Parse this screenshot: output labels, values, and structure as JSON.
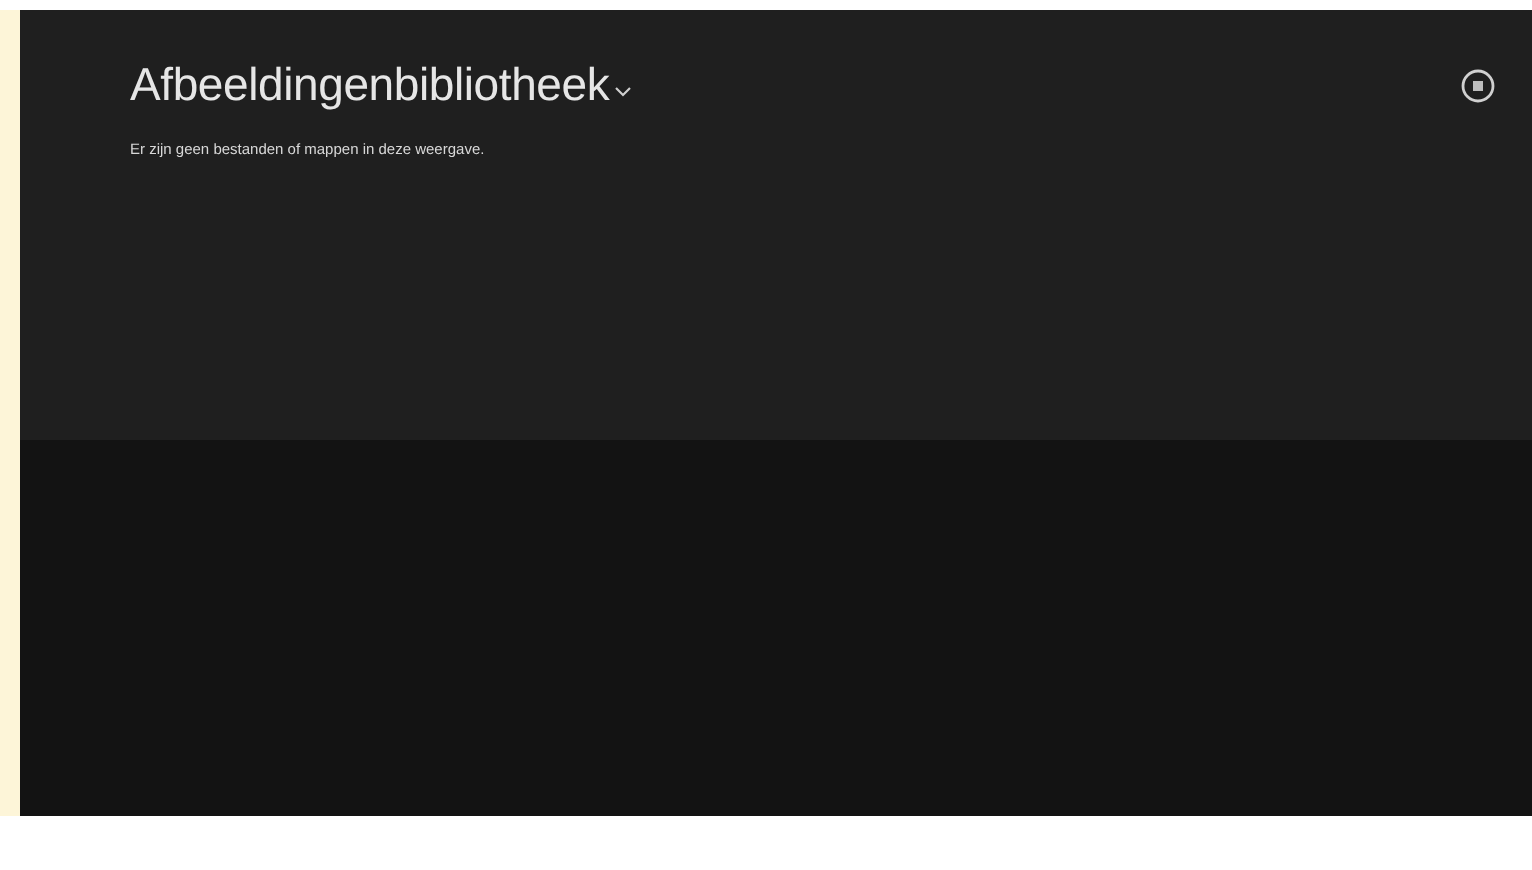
{
  "header": {
    "title": "Afbeeldingenbibliotheek",
    "message": "Er zijn geen bestanden of mappen in deze weergave."
  }
}
